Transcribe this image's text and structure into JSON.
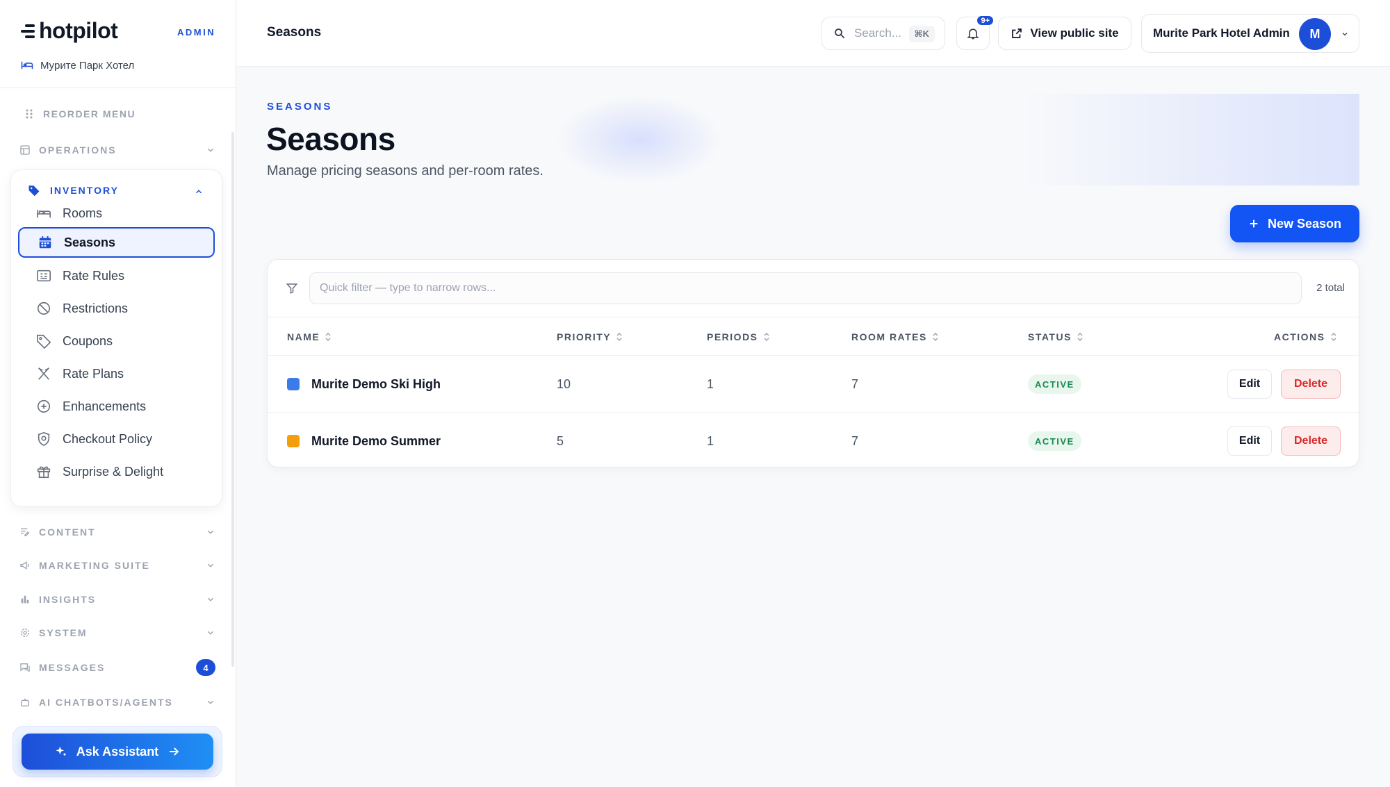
{
  "brand": {
    "name": "hotpilot",
    "tag": "ADMIN",
    "hotel": "Мурите Парк Хотел"
  },
  "sidebar": {
    "reorder_label": "REORDER MENU",
    "sections": {
      "operations": "OPERATIONS",
      "inventory": "INVENTORY",
      "content": "CONTENT",
      "marketing": "MARKETING SUITE",
      "insights": "INSIGHTS",
      "system": "SYSTEM",
      "messages": "MESSAGES",
      "ai": "AI CHATBOTS/AGENTS"
    },
    "messages_count": "4",
    "inventory_items": [
      {
        "label": "Rooms",
        "icon": "bed-icon"
      },
      {
        "label": "Seasons",
        "icon": "calendar-icon",
        "active": true
      },
      {
        "label": "Rate Rules",
        "icon": "rate-rules-icon"
      },
      {
        "label": "Restrictions",
        "icon": "ban-icon"
      },
      {
        "label": "Coupons",
        "icon": "tag-icon"
      },
      {
        "label": "Rate Plans",
        "icon": "utensils-icon"
      },
      {
        "label": "Enhancements",
        "icon": "plus-circle-icon"
      },
      {
        "label": "Checkout Policy",
        "icon": "shield-icon"
      },
      {
        "label": "Surprise & Delight",
        "icon": "gift-icon"
      }
    ],
    "ask_assistant": "Ask Assistant"
  },
  "topbar": {
    "title": "Seasons",
    "search_placeholder": "Search...",
    "search_shortcut": "⌘K",
    "notifications_badge": "9+",
    "view_public_site": "View public site",
    "user_name": "Murite Park Hotel Admin",
    "user_initial": "M"
  },
  "page": {
    "eyebrow": "SEASONS",
    "title": "Seasons",
    "subtitle": "Manage pricing seasons and per-room rates.",
    "new_button": "New Season"
  },
  "table": {
    "filter_placeholder": "Quick filter — type to narrow rows...",
    "total_label": "2 total",
    "columns": {
      "name": "NAME",
      "priority": "PRIORITY",
      "periods": "PERIODS",
      "room_rates": "ROOM RATES",
      "status": "STATUS",
      "actions": "ACTIONS"
    },
    "rows": [
      {
        "color": "#3b7be9",
        "name": "Murite Demo Ski High",
        "priority": "10",
        "periods": "1",
        "room_rates": "7",
        "status": "ACTIVE",
        "edit": "Edit",
        "delete": "Delete"
      },
      {
        "color": "#f59e0b",
        "name": "Murite Demo Summer",
        "priority": "5",
        "periods": "1",
        "room_rates": "7",
        "status": "ACTIVE",
        "edit": "Edit",
        "delete": "Delete"
      }
    ]
  },
  "colors": {
    "accent": "#1d4ed8",
    "primary_button": "#1254f4",
    "status_active": "#16894f",
    "danger": "#dc2626"
  }
}
